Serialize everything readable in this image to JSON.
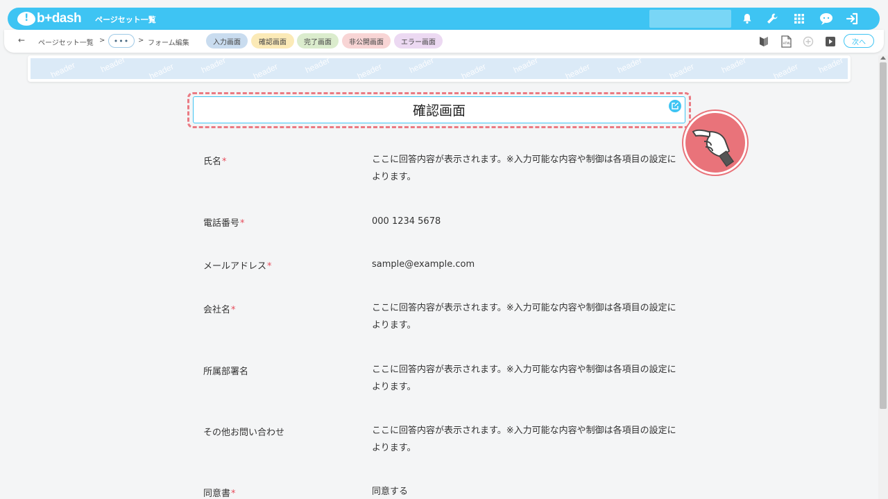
{
  "app": {
    "logo_text": "b+dash",
    "top_title": "ページセット一覧"
  },
  "breadcrumb": {
    "back": "←",
    "item1": "ページセット一覧",
    "sep1": ">",
    "more": "•••",
    "sep2": ">",
    "item2": "フォーム編集"
  },
  "tabs": [
    {
      "label": "入力画面",
      "color": "#c9dcef"
    },
    {
      "label": "確認画面",
      "color": "#fbeab7"
    },
    {
      "label": "完了画面",
      "color": "#dbeccd"
    },
    {
      "label": "非公開画面",
      "color": "#f8d5d5"
    },
    {
      "label": "エラー画面",
      "color": "#ecd9f2"
    }
  ],
  "toolbar": {
    "next_label": "次へ"
  },
  "header_watermark": "header",
  "title": "確認画面",
  "fields": [
    {
      "label": "氏名",
      "required": true,
      "value": "ここに回答内容が表示されます。※入力可能な内容や制御は各項目の設定によります。"
    },
    {
      "label": "電話番号",
      "required": true,
      "value": "000 1234 5678"
    },
    {
      "label": "メールアドレス",
      "required": true,
      "value": "sample@example.com"
    },
    {
      "label": "会社名",
      "required": true,
      "value": "ここに回答内容が表示されます。※入力可能な内容や制御は各項目の設定によります。"
    },
    {
      "label": "所属部署名",
      "required": false,
      "value": "ここに回答内容が表示されます。※入力可能な内容や制御は各項目の設定によります。"
    },
    {
      "label": "その他お問い合わせ",
      "required": false,
      "value": "ここに回答内容が表示されます。※入力可能な内容や制御は各項目の設定によります。"
    },
    {
      "label": "同意書",
      "required": true,
      "value": "同意する"
    }
  ],
  "required_mark": "*",
  "colors": {
    "brand": "#3ec4f3",
    "highlight": "#ea7a83",
    "required": "#e74c5b"
  }
}
